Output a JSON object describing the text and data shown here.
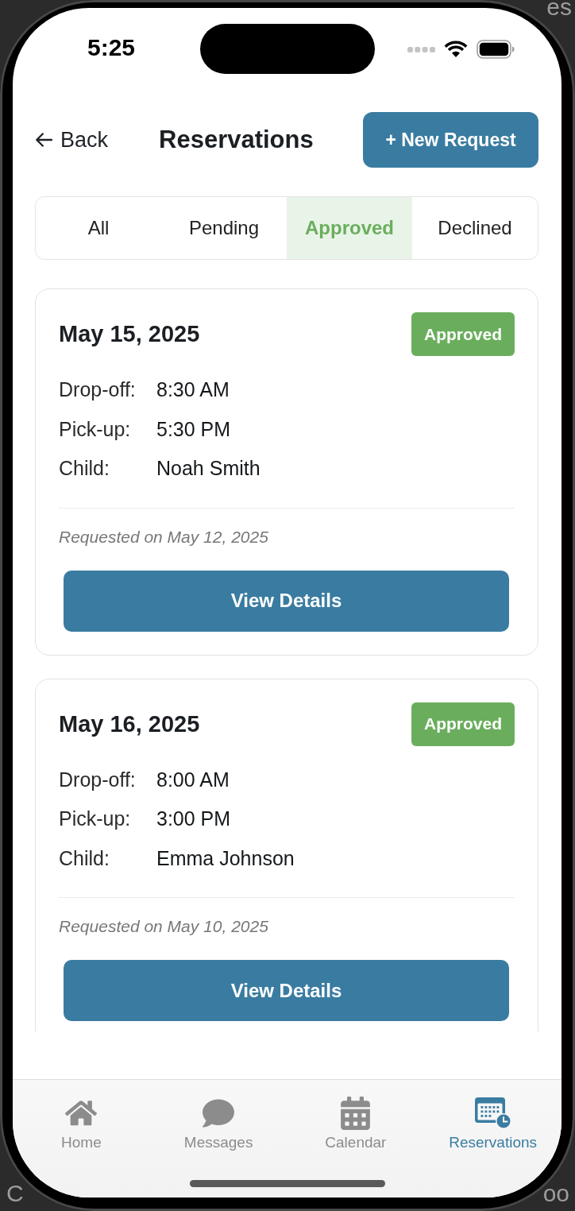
{
  "backdrop": {
    "top_right": "es",
    "bottom_left": "C",
    "bottom_right": "oo"
  },
  "status_bar": {
    "time": "5:25"
  },
  "header": {
    "back": "Back",
    "title": "Reservations",
    "new_request": "+ New Request"
  },
  "filter_tabs": [
    {
      "label": "All",
      "selected": false
    },
    {
      "label": "Pending",
      "selected": false
    },
    {
      "label": "Approved",
      "selected": true
    },
    {
      "label": "Declined",
      "selected": false
    }
  ],
  "reservations": [
    {
      "date": "May 15, 2025",
      "status": {
        "label": "Approved",
        "kind": "approved"
      },
      "details": [
        {
          "label": "Drop-off:",
          "value": "8:30 AM"
        },
        {
          "label": "Pick-up:",
          "value": "5:30 PM"
        },
        {
          "label": "Child:",
          "value": "Noah Smith"
        }
      ],
      "requested": "Requested on May 12, 2025",
      "action": "View Details"
    },
    {
      "date": "May 16, 2025",
      "status": {
        "label": "Approved",
        "kind": "approved"
      },
      "details": [
        {
          "label": "Drop-off:",
          "value": "8:00 AM"
        },
        {
          "label": "Pick-up:",
          "value": "3:00 PM"
        },
        {
          "label": "Child:",
          "value": "Emma Johnson"
        }
      ],
      "requested": "Requested on May 10, 2025",
      "action": "View Details"
    }
  ],
  "tab_bar": [
    {
      "label": "Home",
      "selected": false
    },
    {
      "label": "Messages",
      "selected": false
    },
    {
      "label": "Calendar",
      "selected": false
    },
    {
      "label": "Reservations",
      "selected": true
    }
  ]
}
